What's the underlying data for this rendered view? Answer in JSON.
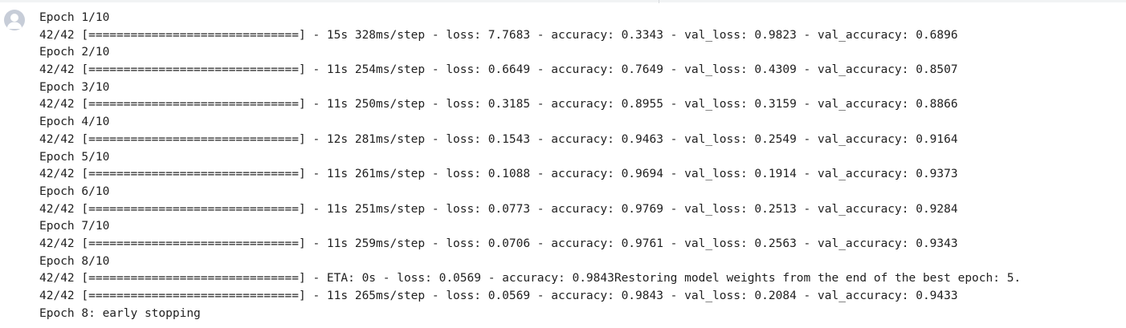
{
  "colors": {
    "text": "#212121",
    "avatar_bg": "#c7cdd8",
    "avatar_fg": "#ffffff",
    "top_border": "#f1f3f4"
  },
  "avatar": {
    "icon": "user-avatar-icon"
  },
  "output": {
    "lines": [
      "Epoch 1/10",
      "42/42 [==============================] - 15s 328ms/step - loss: 7.7683 - accuracy: 0.3343 - val_loss: 0.9823 - val_accuracy: 0.6896",
      "Epoch 2/10",
      "42/42 [==============================] - 11s 254ms/step - loss: 0.6649 - accuracy: 0.7649 - val_loss: 0.4309 - val_accuracy: 0.8507",
      "Epoch 3/10",
      "42/42 [==============================] - 11s 250ms/step - loss: 0.3185 - accuracy: 0.8955 - val_loss: 0.3159 - val_accuracy: 0.8866",
      "Epoch 4/10",
      "42/42 [==============================] - 12s 281ms/step - loss: 0.1543 - accuracy: 0.9463 - val_loss: 0.2549 - val_accuracy: 0.9164",
      "Epoch 5/10",
      "42/42 [==============================] - 11s 261ms/step - loss: 0.1088 - accuracy: 0.9694 - val_loss: 0.1914 - val_accuracy: 0.9373",
      "Epoch 6/10",
      "42/42 [==============================] - 11s 251ms/step - loss: 0.0773 - accuracy: 0.9769 - val_loss: 0.2513 - val_accuracy: 0.9284",
      "Epoch 7/10",
      "42/42 [==============================] - 11s 259ms/step - loss: 0.0706 - accuracy: 0.9761 - val_loss: 0.2563 - val_accuracy: 0.9343",
      "Epoch 8/10",
      "42/42 [==============================] - ETA: 0s - loss: 0.0569 - accuracy: 0.9843Restoring model weights from the end of the best epoch: 5.",
      "42/42 [==============================] - 11s 265ms/step - loss: 0.0569 - accuracy: 0.9843 - val_loss: 0.2084 - val_accuracy: 0.9433",
      "Epoch 8: early stopping"
    ]
  }
}
